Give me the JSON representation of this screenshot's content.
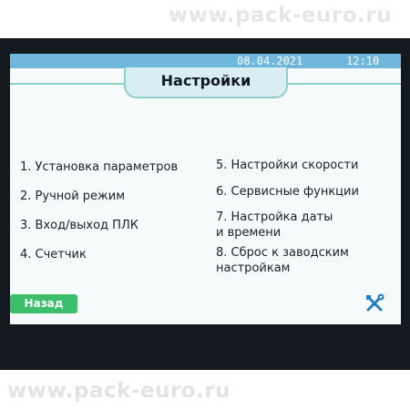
{
  "watermark": "www.pack-euro.ru",
  "header": {
    "date": "08.04.2021",
    "time": "12:10",
    "title": "Настройки"
  },
  "menu": {
    "left": [
      {
        "label": "1. Установка параметров"
      },
      {
        "label": "2. Ручной режим"
      },
      {
        "label": "3. Вход/выход ПЛК"
      },
      {
        "label": "4. Счетчик"
      }
    ],
    "right": [
      {
        "label": "5. Настройки скорости"
      },
      {
        "label": "6. Сервисные функции"
      },
      {
        "line1": "7. Настройка даты",
        "line2": "и времени"
      },
      {
        "line1": "8. Сброс к заводским",
        "line2": "настройкам"
      }
    ]
  },
  "footer": {
    "back_label": "Назад",
    "tools_icon": "tools-icon"
  },
  "colors": {
    "topbar": "#6fb7dc",
    "title_tab": "#d9eef2",
    "accent_line": "#8dcfc9",
    "back_button": "#3cbf6a",
    "bezel": "#14181f",
    "tools_icon": "#1f7fc2"
  }
}
